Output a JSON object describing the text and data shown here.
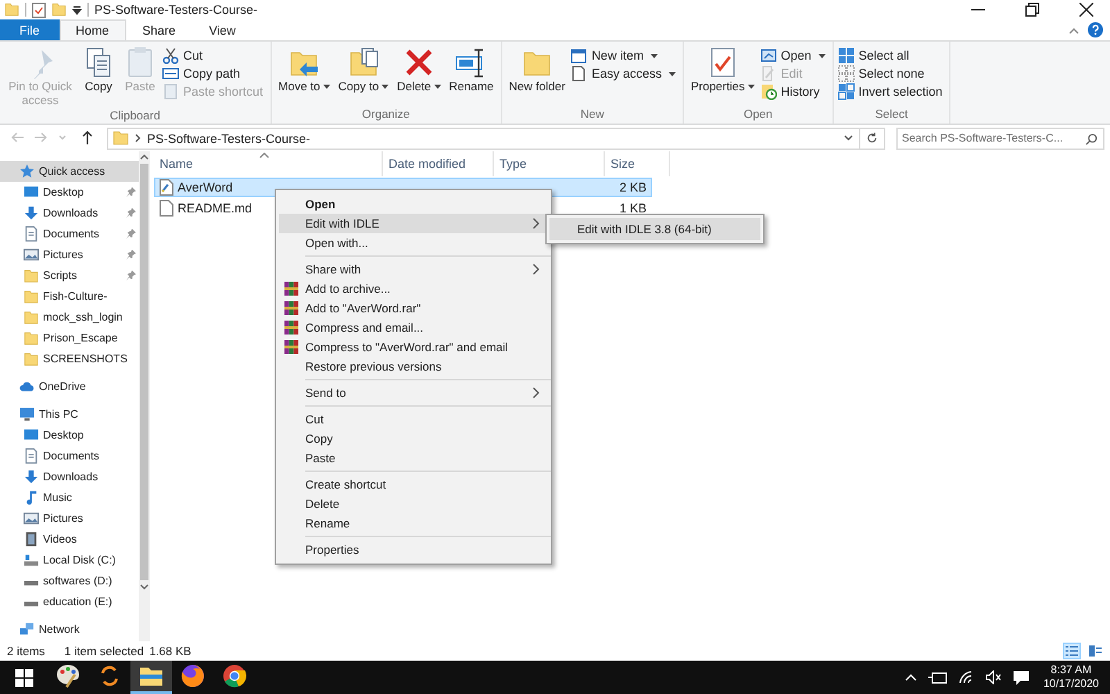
{
  "title_bar": {
    "title": "PS-Software-Testers-Course-"
  },
  "ribbon": {
    "tabs": [
      {
        "label": "File",
        "kind": "file",
        "selected": false
      },
      {
        "label": "Home",
        "kind": "tab",
        "selected": true
      },
      {
        "label": "Share",
        "kind": "tab",
        "selected": false
      },
      {
        "label": "View",
        "kind": "tab",
        "selected": false
      }
    ],
    "groups": [
      {
        "label": "Clipboard",
        "commands": [
          {
            "label": "Pin to Quick access",
            "kind": "large",
            "disabled": true,
            "dropdown": false
          },
          {
            "label": "Copy",
            "kind": "large",
            "disabled": false,
            "dropdown": false
          },
          {
            "label": "Paste",
            "kind": "large",
            "disabled": true,
            "dropdown": false
          },
          {
            "label": "Cut",
            "kind": "small",
            "disabled": false,
            "dropdown": false
          },
          {
            "label": "Copy path",
            "kind": "small",
            "disabled": false,
            "dropdown": false
          },
          {
            "label": "Paste shortcut",
            "kind": "small",
            "disabled": true,
            "dropdown": false
          }
        ]
      },
      {
        "label": "Organize",
        "commands": [
          {
            "label": "Move to",
            "kind": "large",
            "disabled": false,
            "dropdown": true
          },
          {
            "label": "Copy to",
            "kind": "large",
            "disabled": false,
            "dropdown": true
          },
          {
            "label": "Delete",
            "kind": "large",
            "disabled": false,
            "dropdown": true
          },
          {
            "label": "Rename",
            "kind": "large",
            "disabled": false,
            "dropdown": false
          }
        ]
      },
      {
        "label": "New",
        "commands": [
          {
            "label": "New folder",
            "kind": "large",
            "disabled": false,
            "dropdown": false
          },
          {
            "label": "New item",
            "kind": "small",
            "disabled": false,
            "dropdown": true
          },
          {
            "label": "Easy access",
            "kind": "small",
            "disabled": false,
            "dropdown": true
          }
        ]
      },
      {
        "label": "Open",
        "commands": [
          {
            "label": "Properties",
            "kind": "large",
            "disabled": false,
            "dropdown": true
          },
          {
            "label": "Open",
            "kind": "small",
            "disabled": false,
            "dropdown": true
          },
          {
            "label": "Edit",
            "kind": "small",
            "disabled": true,
            "dropdown": false
          },
          {
            "label": "History",
            "kind": "small",
            "disabled": false,
            "dropdown": false
          }
        ]
      },
      {
        "label": "Select",
        "commands": [
          {
            "label": "Select all",
            "kind": "small",
            "disabled": false,
            "dropdown": false
          },
          {
            "label": "Select none",
            "kind": "small",
            "disabled": false,
            "dropdown": false
          },
          {
            "label": "Invert selection",
            "kind": "small",
            "disabled": false,
            "dropdown": false
          }
        ]
      }
    ]
  },
  "address_bar": {
    "nav": [
      {
        "kind": "back",
        "disabled": true
      },
      {
        "kind": "forward",
        "disabled": true
      },
      {
        "kind": "recent",
        "disabled": true
      },
      {
        "kind": "up",
        "disabled": false
      }
    ],
    "path": "PS-Software-Testers-Course-",
    "search": {
      "placeholder": "Search PS-Software-Testers-C..."
    }
  },
  "sidebar": {
    "items": [
      {
        "label": "Quick access",
        "kind": "star",
        "selected": true,
        "children": [
          {
            "label": "Desktop",
            "kind": "desktop",
            "selected": false,
            "pinned": true
          },
          {
            "label": "Downloads",
            "kind": "downloads",
            "selected": false,
            "pinned": true
          },
          {
            "label": "Documents",
            "kind": "documents",
            "selected": false,
            "pinned": true
          },
          {
            "label": "Pictures",
            "kind": "pictures",
            "selected": false,
            "pinned": true
          },
          {
            "label": "Scripts",
            "kind": "folder",
            "selected": false,
            "pinned": true
          },
          {
            "label": "Fish-Culture-",
            "kind": "folder",
            "selected": false,
            "pinned": false
          },
          {
            "label": "mock_ssh_login",
            "kind": "folder",
            "selected": false,
            "pinned": false
          },
          {
            "label": "Prison_Escape",
            "kind": "folder",
            "selected": false,
            "pinned": false
          },
          {
            "label": "SCREENSHOTS",
            "kind": "folder",
            "selected": false,
            "pinned": false
          }
        ]
      },
      {
        "label": "OneDrive",
        "kind": "cloud",
        "selected": false
      },
      {
        "label": "This PC",
        "kind": "pc",
        "selected": false,
        "children": [
          {
            "label": "Desktop",
            "kind": "desktop",
            "selected": false,
            "pinned": false
          },
          {
            "label": "Documents",
            "kind": "documents",
            "selected": false,
            "pinned": false
          },
          {
            "label": "Downloads",
            "kind": "downloads",
            "selected": false,
            "pinned": false
          },
          {
            "label": "Music",
            "kind": "music",
            "selected": false,
            "pinned": false
          },
          {
            "label": "Pictures",
            "kind": "pictures",
            "selected": false,
            "pinned": false
          },
          {
            "label": "Videos",
            "kind": "videos",
            "selected": false,
            "pinned": false
          },
          {
            "label": "Local Disk (C:)",
            "kind": "system-drive",
            "selected": false,
            "pinned": false
          },
          {
            "label": "softwares (D:)",
            "kind": "drive",
            "selected": false,
            "pinned": false
          },
          {
            "label": "education (E:)",
            "kind": "drive",
            "selected": false,
            "pinned": false
          }
        ]
      },
      {
        "label": "Network",
        "kind": "network",
        "selected": false
      }
    ]
  },
  "file_list": {
    "columns": [
      {
        "label": "Name",
        "sorted": true
      },
      {
        "label": "Date modified",
        "sorted": false
      },
      {
        "label": "Type",
        "sorted": false
      },
      {
        "label": "Size",
        "sorted": false
      }
    ],
    "rows": [
      {
        "name": "AverWord",
        "kind": "script",
        "size": "2 KB",
        "selected": true
      },
      {
        "name": "README.md",
        "kind": "text",
        "size": "1 KB",
        "selected": false
      }
    ]
  },
  "context_menu": {
    "items": [
      {
        "label": "Open",
        "bold": true,
        "selected": false,
        "submenu": false,
        "icon": false,
        "separator_before": false
      },
      {
        "label": "Edit with IDLE",
        "bold": false,
        "selected": true,
        "submenu": true,
        "icon": false,
        "separator_before": false
      },
      {
        "label": "Open with...",
        "bold": false,
        "selected": false,
        "submenu": false,
        "icon": false,
        "separator_before": false
      },
      {
        "label": "Share with",
        "bold": false,
        "selected": false,
        "submenu": true,
        "icon": false,
        "separator_before": true
      },
      {
        "label": "Add to archive...",
        "bold": false,
        "selected": false,
        "submenu": false,
        "icon": true,
        "separator_before": false
      },
      {
        "label": "Add to \"AverWord.rar\"",
        "bold": false,
        "selected": false,
        "submenu": false,
        "icon": true,
        "separator_before": false
      },
      {
        "label": "Compress and email...",
        "bold": false,
        "selected": false,
        "submenu": false,
        "icon": true,
        "separator_before": false
      },
      {
        "label": "Compress to \"AverWord.rar\" and email",
        "bold": false,
        "selected": false,
        "submenu": false,
        "icon": true,
        "separator_before": false
      },
      {
        "label": "Restore previous versions",
        "bold": false,
        "selected": false,
        "submenu": false,
        "icon": false,
        "separator_before": false
      },
      {
        "label": "Send to",
        "bold": false,
        "selected": false,
        "submenu": true,
        "icon": false,
        "separator_before": true
      },
      {
        "label": "Cut",
        "bold": false,
        "selected": false,
        "submenu": false,
        "icon": false,
        "separator_before": true
      },
      {
        "label": "Copy",
        "bold": false,
        "selected": false,
        "submenu": false,
        "icon": false,
        "separator_before": false
      },
      {
        "label": "Paste",
        "bold": false,
        "selected": false,
        "submenu": false,
        "icon": false,
        "separator_before": false
      },
      {
        "label": "Create shortcut",
        "bold": false,
        "selected": false,
        "submenu": false,
        "icon": false,
        "separator_before": true
      },
      {
        "label": "Delete",
        "bold": false,
        "selected": false,
        "submenu": false,
        "icon": false,
        "separator_before": false
      },
      {
        "label": "Rename",
        "bold": false,
        "selected": false,
        "submenu": false,
        "icon": false,
        "separator_before": false
      },
      {
        "label": "Properties",
        "bold": false,
        "selected": false,
        "submenu": false,
        "icon": false,
        "separator_before": true
      }
    ],
    "submenu": {
      "items": [
        {
          "label": "Edit with IDLE 3.8 (64-bit)",
          "selected": true
        }
      ]
    }
  },
  "status_bar": {
    "item_count": "2 items",
    "selection": "1 item selected",
    "size": "1.68 KB",
    "view_buttons": [
      {
        "kind": "details",
        "selected": true
      },
      {
        "kind": "large-icons",
        "selected": false
      }
    ]
  },
  "taskbar": {
    "apps": [
      {
        "kind": "paint",
        "active": false
      },
      {
        "kind": "sync",
        "active": false
      },
      {
        "kind": "explorer",
        "active": true
      },
      {
        "kind": "firefox",
        "active": false
      },
      {
        "kind": "chrome",
        "active": false
      }
    ],
    "time": "8:37 AM",
    "date": "10/17/2020"
  }
}
